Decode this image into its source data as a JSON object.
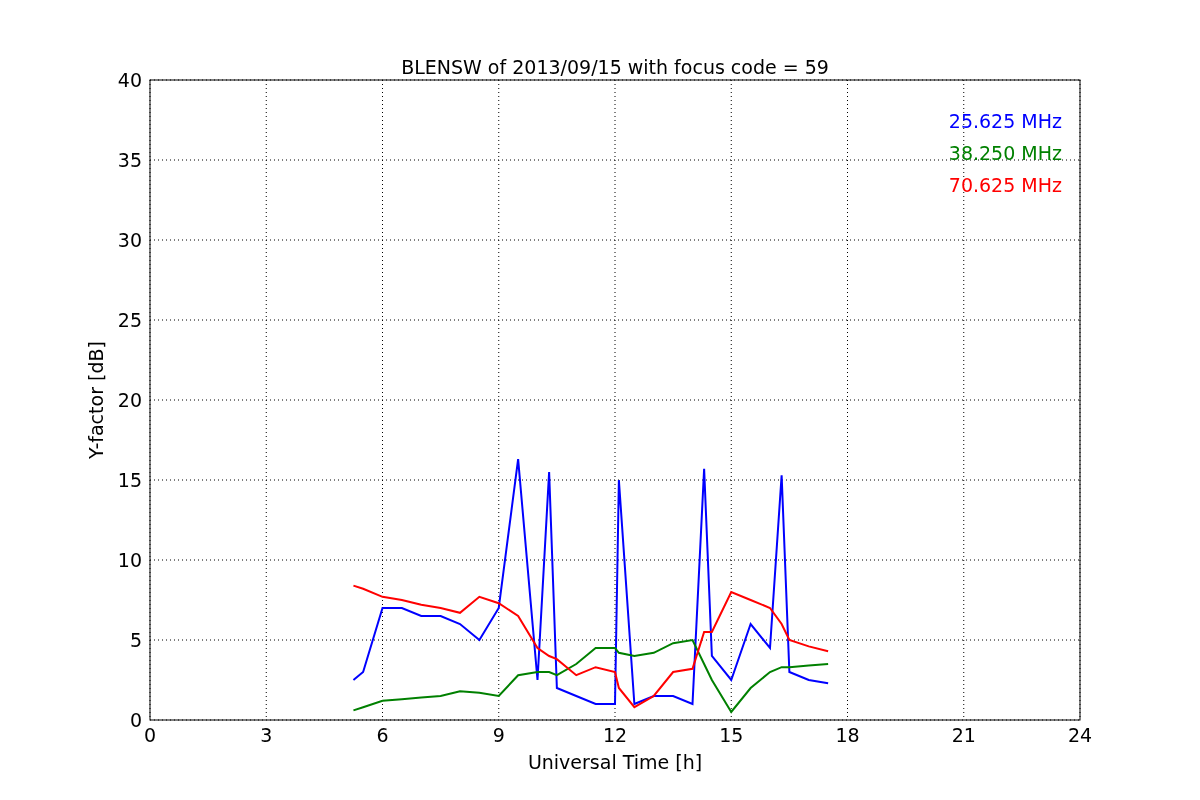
{
  "chart_data": {
    "type": "line",
    "title": "BLENSW of 2013/09/15 with focus code = 59",
    "xlabel": "Universal Time [h]",
    "ylabel": "Y-factor [dB]",
    "xlim": [
      0,
      24
    ],
    "ylim": [
      0,
      40
    ],
    "xticks": [
      0,
      3,
      6,
      9,
      12,
      15,
      18,
      21,
      24
    ],
    "yticks": [
      0,
      5,
      10,
      15,
      20,
      25,
      30,
      35,
      40
    ],
    "grid": true,
    "x": [
      5.25,
      5.5,
      6,
      6.5,
      7,
      7.5,
      8,
      8.5,
      9,
      9.5,
      10,
      10.3,
      10.5,
      11,
      11.5,
      12,
      12.1,
      12.5,
      13,
      13.5,
      14,
      14.3,
      14.5,
      15,
      15.5,
      16,
      16.3,
      16.5,
      17,
      17.5
    ],
    "series": [
      {
        "name": "25.625 MHz",
        "color": "#0000ff",
        "values": [
          2.5,
          3,
          7,
          7,
          6.5,
          6.5,
          6,
          5,
          7,
          16.3,
          2.5,
          15.5,
          2,
          1.5,
          1,
          1,
          15,
          1,
          1.5,
          1.5,
          1,
          15.7,
          4,
          2.5,
          6,
          4.5,
          15.3,
          3,
          2.5,
          2.3
        ]
      },
      {
        "name": "38.250 MHz",
        "color": "#008000",
        "values": [
          0.6,
          0.8,
          1.2,
          1.3,
          1.4,
          1.5,
          1.8,
          1.7,
          1.5,
          2.8,
          3,
          3,
          2.8,
          3.5,
          4.5,
          4.5,
          4.2,
          4,
          4.2,
          4.8,
          5,
          3.5,
          2.5,
          0.5,
          2,
          3,
          3.3,
          3.3,
          3.4,
          3.5
        ]
      },
      {
        "name": "70.625 MHz",
        "color": "#ff0000",
        "values": [
          8.4,
          8.2,
          7.7,
          7.5,
          7.2,
          7,
          6.7,
          7.7,
          7.3,
          6.5,
          4.5,
          4,
          3.8,
          2.8,
          3.3,
          3,
          2,
          0.8,
          1.5,
          3,
          3.2,
          5.5,
          5.5,
          8,
          7.5,
          7,
          6,
          5,
          4.6,
          4.3
        ]
      }
    ]
  }
}
